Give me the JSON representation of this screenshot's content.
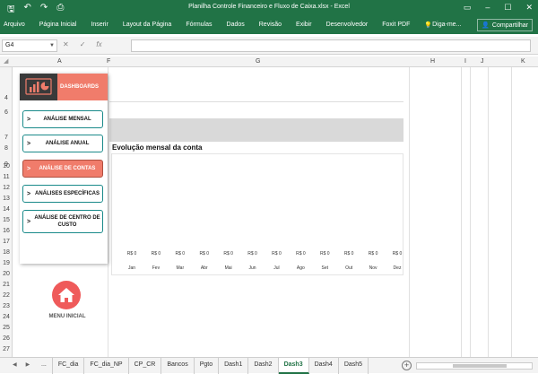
{
  "window": {
    "title": "Planilha Controle Financeiro e Fluxo de Caixa.xlsx - Excel",
    "quick_access": [
      "save-icon",
      "undo-icon",
      "redo-icon",
      "print-preview-icon"
    ]
  },
  "ribbon": {
    "tabs": [
      "Arquivo",
      "Página Inicial",
      "Inserir",
      "Layout da Página",
      "Fórmulas",
      "Dados",
      "Revisão",
      "Exibir",
      "Desenvolvedor",
      "Foxit PDF",
      "Diga-me..."
    ],
    "share_label": "Compartilhar"
  },
  "formula_bar": {
    "name_box": "G4",
    "fx_label": "fx",
    "value": ""
  },
  "columns": [
    "A",
    "F",
    "G",
    "H",
    "I",
    "J",
    "K"
  ],
  "rows": [
    "4",
    "6",
    "7",
    "8",
    "9",
    "10",
    "11",
    "12",
    "13",
    "14",
    "15",
    "16",
    "17",
    "18",
    "19",
    "20",
    "21",
    "22",
    "23",
    "24",
    "25",
    "26",
    "27",
    "28",
    "29",
    "30",
    "31",
    "32",
    "33"
  ],
  "menu": {
    "header_label": "DASHBOARDS",
    "items": [
      {
        "label": "ANÁLISE MENSAL",
        "active": false
      },
      {
        "label": "ANÁLISE ANUAL",
        "active": false
      },
      {
        "label": "ANÁLISE DE CONTAS",
        "active": true
      },
      {
        "label": "ANÁLISES ESPECÍFICAS",
        "active": false
      },
      {
        "label": "ANÁLISE DE CENTRO DE CUSTO",
        "active": false
      }
    ],
    "home_label": "MENU INICIAL"
  },
  "chart_data": {
    "type": "bar",
    "title": "Evolução mensal da conta",
    "categories": [
      "Jan",
      "Fev",
      "Mar",
      "Abr",
      "Mai",
      "Jun",
      "Jul",
      "Ago",
      "Set",
      "Out",
      "Nov",
      "Dez"
    ],
    "values": [
      0,
      0,
      0,
      0,
      0,
      0,
      0,
      0,
      0,
      0,
      0,
      0
    ],
    "data_labels": [
      "R$ 0",
      "R$ 0",
      "R$ 0",
      "R$ 0",
      "R$ 0",
      "R$ 0",
      "R$ 0",
      "R$ 0",
      "R$ 0",
      "R$ 0",
      "R$ 0",
      "R$ 0"
    ],
    "grid": false,
    "legend": "none"
  },
  "sheet_tabs": {
    "items": [
      "...",
      "FC_dia",
      "FC_dia_NP",
      "CP_CR",
      "Bancos",
      "Pgto",
      "Dash1",
      "Dash2",
      "Dash3",
      "Dash4",
      "Dash5"
    ],
    "active": "Dash3"
  },
  "colors": {
    "excel_green": "#217346",
    "accent_coral": "#f07c6b",
    "teal_border": "#1a8a8a",
    "home_red": "#ef5a5a"
  }
}
